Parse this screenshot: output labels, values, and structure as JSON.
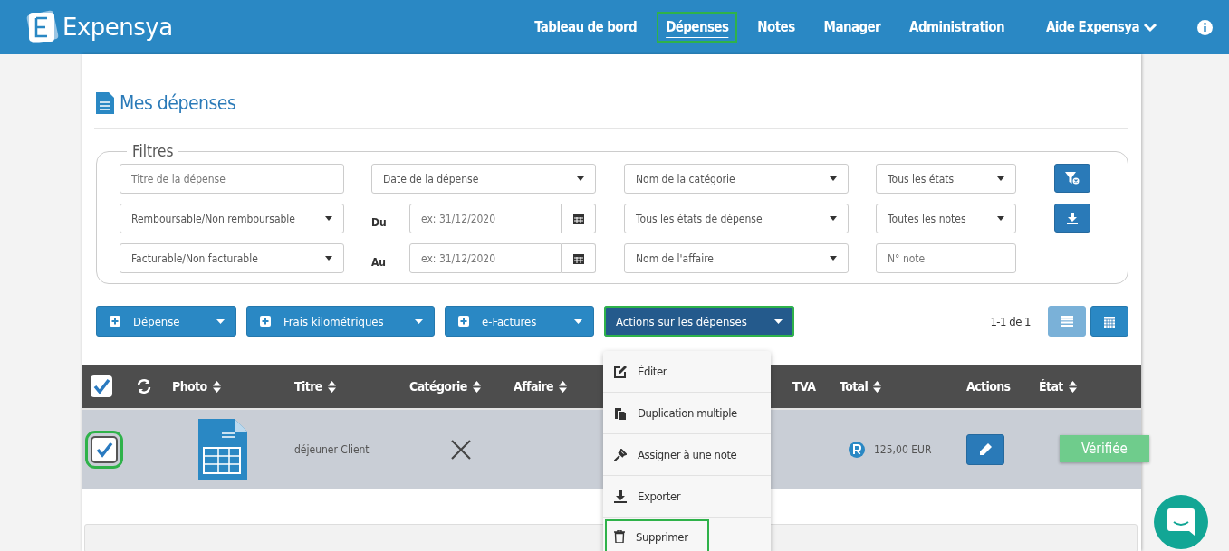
{
  "brand": {
    "name": "Expensya"
  },
  "nav": [
    {
      "label": "Tableau de bord",
      "selected": false,
      "highlighted": false
    },
    {
      "label": "Dépenses",
      "selected": true,
      "highlighted": true
    },
    {
      "label": "Notes",
      "selected": false,
      "highlighted": false
    },
    {
      "label": "Manager",
      "selected": false,
      "highlighted": false
    },
    {
      "label": "Administration",
      "selected": false,
      "highlighted": false
    }
  ],
  "help_menu": {
    "label": "Aide Expensya"
  },
  "page_title": "Mes dépenses",
  "filters": {
    "legend": "Filtres",
    "rows": [
      [
        {
          "kind": "text",
          "placeholder": "Titre de la dépense"
        },
        {
          "kind": "select",
          "value": "Date de la dépense"
        },
        {
          "kind": "select",
          "value": "Nom de la catégorie"
        },
        {
          "kind": "select",
          "value": "Tous les états"
        },
        {
          "kind": "button"
        }
      ],
      [
        {
          "kind": "select",
          "value": "Remboursable/Non remboursable"
        },
        {
          "kind": "date",
          "label": "Du",
          "placeholder": "ex: 31/12/2020"
        },
        {
          "kind": "select",
          "value": "Tous les états de dépense"
        },
        {
          "kind": "select",
          "value": "Toutes les notes"
        },
        {
          "kind": "button"
        }
      ],
      [
        {
          "kind": "select",
          "value": "Facturable/Non facturable"
        },
        {
          "kind": "date",
          "label": "Au",
          "placeholder": "ex: 31/12/2020"
        },
        {
          "kind": "select",
          "value": "Nom de l'affaire"
        },
        {
          "kind": "text",
          "placeholder": "N° note"
        }
      ]
    ]
  },
  "toolbar": [
    {
      "label": "Dépense",
      "kind": "add",
      "highlighted": false
    },
    {
      "label": "Frais kilométriques",
      "kind": "add",
      "highlighted": false
    },
    {
      "label": "e-Factures",
      "kind": "add",
      "highlighted": false
    },
    {
      "label": "Actions sur les dépenses",
      "kind": "actions",
      "highlighted": true
    }
  ],
  "pagination": "1-1 de 1",
  "view_buttons": [
    {
      "kind": "list",
      "selected": true
    },
    {
      "kind": "calendar",
      "selected": false
    }
  ],
  "table": {
    "all_checked": true,
    "columns": [
      {
        "label": "Photo",
        "sortable": true
      },
      {
        "label": "Titre",
        "sortable": true
      },
      {
        "label": "Catégorie",
        "sortable": true
      },
      {
        "label": "Affaire",
        "sortable": true
      },
      {
        "label": "TVA",
        "sortable": false
      },
      {
        "label": "Total",
        "sortable": true
      },
      {
        "label": "Actions",
        "sortable": false
      },
      {
        "label": "État",
        "sortable": true
      }
    ],
    "rows": [
      {
        "checked": true,
        "highlighted": true,
        "title": "déjeuner Client",
        "total": "125,00 EUR",
        "status": "Vérifiée"
      }
    ]
  },
  "actions_menu": [
    {
      "label": "Éditer",
      "kind": "edit",
      "highlighted": false
    },
    {
      "label": "Duplication multiple",
      "kind": "duplicate",
      "highlighted": false
    },
    {
      "label": "Assigner à une note",
      "kind": "assign",
      "highlighted": false
    },
    {
      "label": "Exporter",
      "kind": "export",
      "highlighted": false
    },
    {
      "label": "Supprimer",
      "kind": "delete",
      "highlighted": true
    }
  ]
}
